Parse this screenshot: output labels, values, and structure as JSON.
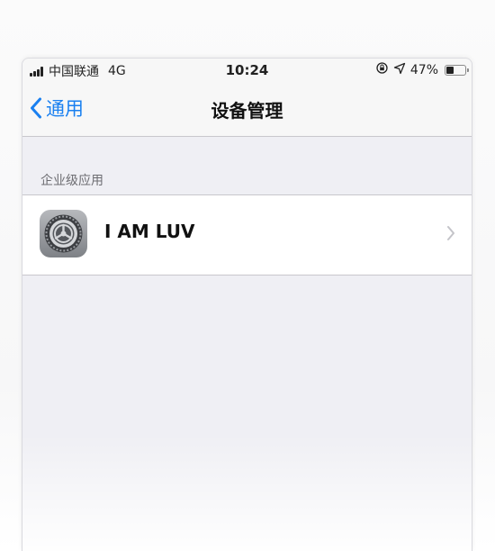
{
  "status_bar": {
    "carrier": "中国联通",
    "network": "4G",
    "time": "10:24",
    "battery": "47%",
    "battery_level": 0.47
  },
  "nav": {
    "back_label": "通用",
    "title": "设备管理"
  },
  "section": {
    "header": "企业级应用",
    "items": [
      {
        "label": "I AM LUV",
        "icon": "settings-gear-icon"
      }
    ]
  },
  "colors": {
    "accent": "#1a80f0",
    "background": "#efeff4",
    "cell": "#ffffff",
    "separator": "#c8c7cc"
  }
}
